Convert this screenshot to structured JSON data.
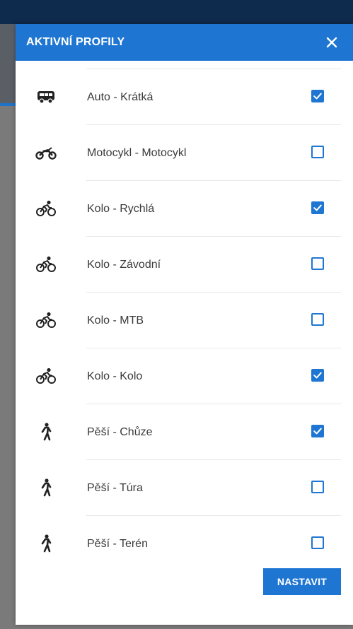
{
  "dialog": {
    "title": "AKTIVNÍ PROFILY",
    "close_icon": "close-icon",
    "action_label": "NASTAVIT",
    "accent_color": "#1f76d2"
  },
  "profiles": [
    {
      "label": "Auto - Krátká",
      "icon": "car-icon",
      "checked": true
    },
    {
      "label": "Motocykl - Motocykl",
      "icon": "motorcycle-icon",
      "checked": false
    },
    {
      "label": "Kolo - Rychlá",
      "icon": "bicycle-icon",
      "checked": true
    },
    {
      "label": "Kolo - Závodní",
      "icon": "bicycle-icon",
      "checked": false
    },
    {
      "label": "Kolo - MTB",
      "icon": "bicycle-icon",
      "checked": false
    },
    {
      "label": "Kolo - Kolo",
      "icon": "bicycle-icon",
      "checked": true
    },
    {
      "label": "Pěší - Chůze",
      "icon": "walk-icon",
      "checked": true
    },
    {
      "label": "Pěší - Túra",
      "icon": "walk-icon",
      "checked": false
    },
    {
      "label": "Pěší - Terén",
      "icon": "walk-icon",
      "checked": false
    }
  ]
}
